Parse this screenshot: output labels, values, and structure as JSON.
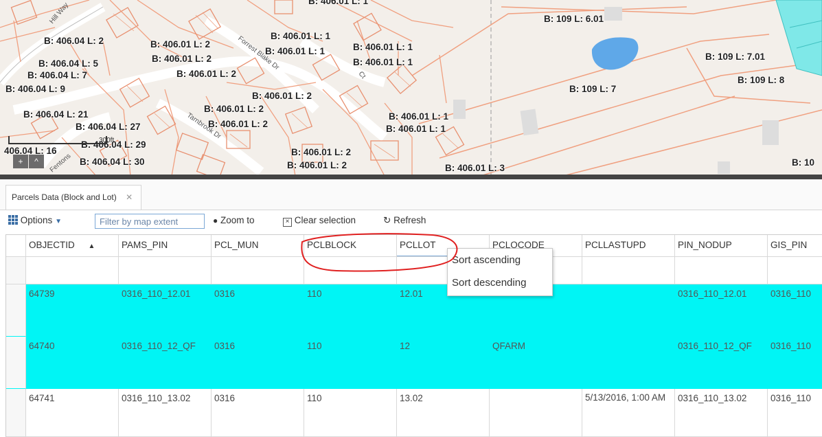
{
  "map": {
    "labels": [
      "B: 406.01 L: 1",
      "B: 406.04 L: 2",
      "B: 406.04 L: 5",
      "B: 406.04 L: 7",
      "B: 406.04 L: 9",
      "B: 406.01 L: 2",
      "B: 406.01 L: 2",
      "B: 406.01 L: 2",
      "B: 406.01 L: 1",
      "B: 406.01 L: 1",
      "B: 406.01 L: 1",
      "B: 406.01 L: 1",
      "B: 406.01 L: 2",
      "B: 406.04 L: 21",
      "B: 406.04 L: 27",
      "B: 406.01 L: 2",
      "B: 406.01 L: 2",
      "B: 406.01 L: 1",
      "B: 406.01 L: 1",
      "406.04 L: 16",
      "B: 406.04 L: 29",
      "B: 406.04 L: 30",
      "B: 406.01 L: 2",
      "B: 406.01 L: 2",
      "B: 406.01 L: 3",
      "B: 109 L: 6.01",
      "B: 109 L: 7.01",
      "B: 109 L: 8",
      "B: 109 L: 7",
      "B: 10"
    ],
    "streets": [
      "Hill Way",
      "Forrest Blake Dr",
      "Tarnbrook Dr",
      "Ct",
      "Fentons"
    ],
    "scale_text": "300ft",
    "nav_plus": "+",
    "nav_up": "^"
  },
  "panel": {
    "tab_label": "Parcels Data (Block and Lot)",
    "tab_close": "✕",
    "toolbar": {
      "options_label": "Options",
      "filter_label": "Filter by map extent",
      "zoom_label": "Zoom to",
      "clear_label": "Clear selection",
      "refresh_label": "Refresh"
    }
  },
  "grid": {
    "sort_indicator": "▲",
    "columns": [
      "OBJECTID",
      "PAMS_PIN",
      "PCL_MUN",
      "PCLBLOCK",
      "PCLLOT",
      "PCLOCODE",
      "PCLLASTUPD",
      "PIN_NODUP",
      "GIS_PIN"
    ],
    "rows": [
      [
        "64739",
        "0316_110_12.01",
        "0316",
        "110",
        "12.01",
        "",
        "",
        "0316_110_12.01",
        "0316_110"
      ],
      [
        "64740",
        "0316_110_12_QF",
        "0316",
        "110",
        "12",
        "QFARM",
        "",
        "0316_110_12_QF",
        "0316_110"
      ],
      [
        "64741",
        "0316_110_13.02",
        "0316",
        "110",
        "13.02",
        "",
        "5/13/2016, 1:00 AM",
        "0316_110_13.02",
        "0316_110"
      ]
    ]
  },
  "menu": {
    "sort_ascending": "Sort ascending",
    "sort_descending": "Sort descending"
  },
  "colors": {
    "selected_row": "#00f5f5",
    "annotation": "#e02020",
    "parcel_line": "#f0a080"
  }
}
